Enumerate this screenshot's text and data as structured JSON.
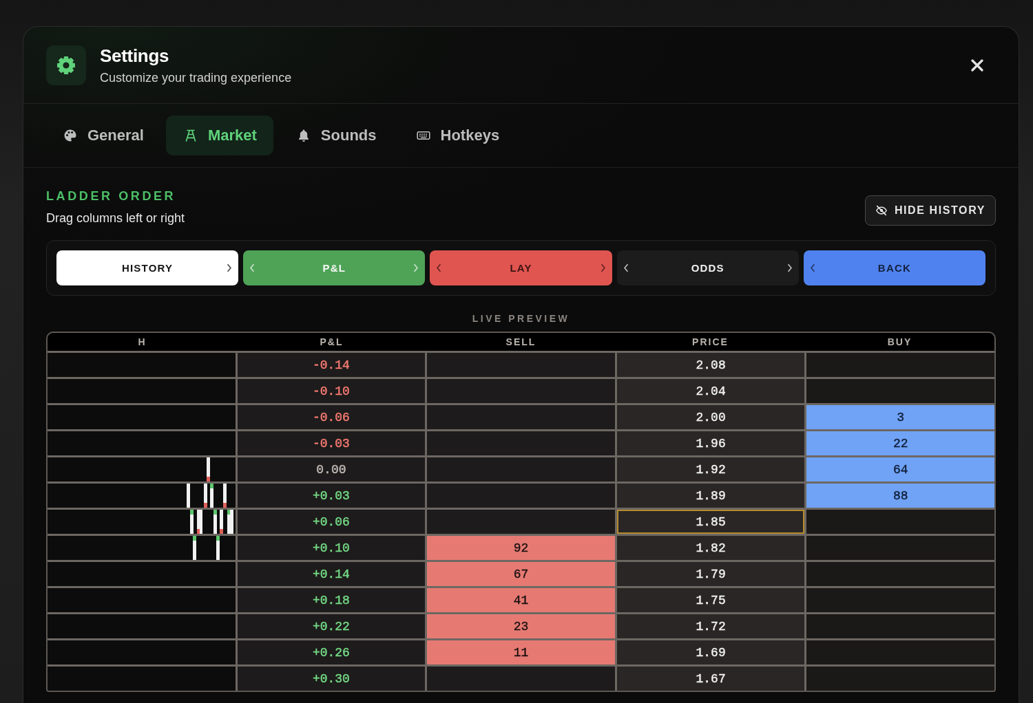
{
  "dialog": {
    "title": "Settings",
    "subtitle": "Customize your trading experience"
  },
  "tabs": [
    {
      "label": "General",
      "selected": false
    },
    {
      "label": "Market",
      "selected": true
    },
    {
      "label": "Sounds",
      "selected": false
    },
    {
      "label": "Hotkeys",
      "selected": false
    }
  ],
  "ladder_order": {
    "heading": "LADDER ORDER",
    "description": "Drag columns left or right",
    "toggle_button": "HIDE HISTORY",
    "columns": [
      {
        "label": "HISTORY",
        "kind": "history",
        "color": "#ffffff",
        "move_left": false,
        "move_right": true
      },
      {
        "label": "P&L",
        "kind": "pnl",
        "color": "#4ea357",
        "move_left": true,
        "move_right": true
      },
      {
        "label": "LAY",
        "kind": "lay",
        "color": "#e05550",
        "move_left": true,
        "move_right": true
      },
      {
        "label": "ODDS",
        "kind": "odds",
        "color": "#1c1c1c",
        "move_left": true,
        "move_right": true
      },
      {
        "label": "BACK",
        "kind": "back",
        "color": "#4f82ee",
        "move_left": true,
        "move_right": false
      }
    ]
  },
  "live_preview": {
    "label": "LIVE PREVIEW",
    "columns": [
      "H",
      "P&L",
      "SELL",
      "PRICE",
      "BUY"
    ],
    "rows": [
      {
        "pnl": {
          "value": "-0.14",
          "color": "#f0786f"
        },
        "price": "2.08",
        "last_traded": false
      },
      {
        "pnl": {
          "value": "-0.10",
          "color": "#f0786f"
        },
        "price": "2.04",
        "last_traded": false
      },
      {
        "pnl": {
          "value": "-0.06",
          "color": "#f0786f"
        },
        "price": "2.00",
        "buy": "3",
        "last_traded": false
      },
      {
        "pnl": {
          "value": "-0.03",
          "color": "#f0786f"
        },
        "price": "1.96",
        "buy": "22",
        "last_traded": false
      },
      {
        "pnl": {
          "value": "0.00",
          "color": "#bdb7b2"
        },
        "price": "1.92",
        "buy": "64",
        "last_traded": false
      },
      {
        "pnl": {
          "value": "+0.03",
          "color": "#72d683"
        },
        "price": "1.89",
        "buy": "88",
        "last_traded": false
      },
      {
        "pnl": {
          "value": "+0.06",
          "color": "#72d683"
        },
        "price": "1.85",
        "last_traded": true
      },
      {
        "pnl": {
          "value": "+0.10",
          "color": "#72d683"
        },
        "sell": "92",
        "price": "1.82",
        "last_traded": false
      },
      {
        "pnl": {
          "value": "+0.14",
          "color": "#72d683"
        },
        "sell": "67",
        "price": "1.79",
        "last_traded": false
      },
      {
        "pnl": {
          "value": "+0.18",
          "color": "#72d683"
        },
        "sell": "41",
        "price": "1.75",
        "last_traded": false
      },
      {
        "pnl": {
          "value": "+0.22",
          "color": "#72d683"
        },
        "sell": "23",
        "price": "1.72",
        "last_traded": false
      },
      {
        "pnl": {
          "value": "+0.26",
          "color": "#72d683"
        },
        "sell": "11",
        "price": "1.69",
        "last_traded": false
      },
      {
        "pnl": {
          "value": "+0.30",
          "color": "#72d683"
        },
        "price": "1.67",
        "last_traded": false
      }
    ]
  }
}
